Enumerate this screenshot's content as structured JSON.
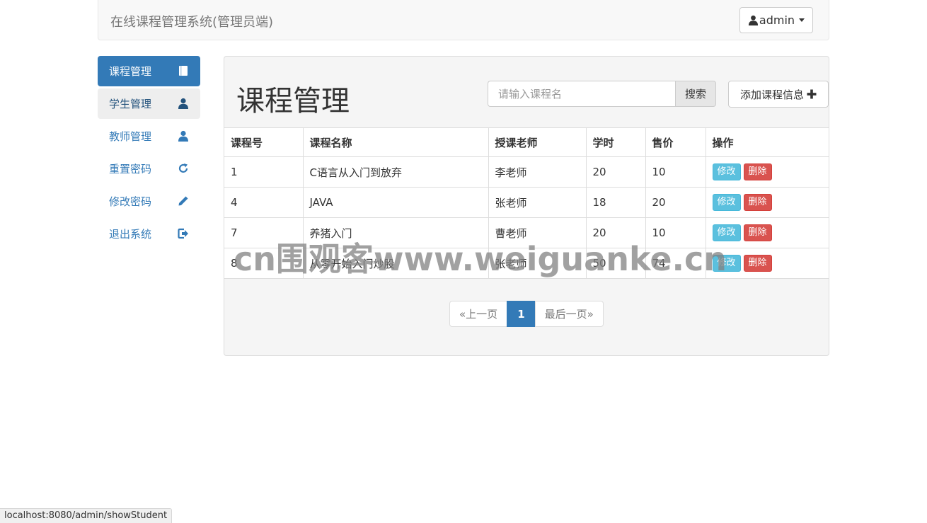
{
  "header": {
    "brand": "在线课程管理系统(管理员端)",
    "user_label": "admin"
  },
  "sidebar": {
    "items": [
      {
        "label": "课程管理",
        "icon": "book-icon"
      },
      {
        "label": "学生管理",
        "icon": "user-icon"
      },
      {
        "label": "教师管理",
        "icon": "user-icon"
      },
      {
        "label": "重置密码",
        "icon": "refresh-icon"
      },
      {
        "label": "修改密码",
        "icon": "pencil-icon"
      },
      {
        "label": "退出系统",
        "icon": "logout-icon"
      }
    ]
  },
  "main": {
    "title": "课程管理",
    "search_placeholder": "请输入课程名",
    "search_button": "搜索",
    "add_button": "添加课程信息"
  },
  "table": {
    "headers": [
      "课程号",
      "课程名称",
      "授课老师",
      "学时",
      "售价",
      "操作"
    ],
    "rows": [
      [
        "1",
        "C语言从入门到放弃",
        "李老师",
        "20",
        "10"
      ],
      [
        "4",
        "JAVA",
        "张老师",
        "18",
        "20"
      ],
      [
        "7",
        "养猪入门",
        "曹老师",
        "20",
        "10"
      ],
      [
        "8",
        "从零开始入门炒股",
        "张老师",
        "50",
        "74"
      ]
    ],
    "edit_label": "修改",
    "delete_label": "删除"
  },
  "pagination": {
    "prev": "«上一页",
    "current": "1",
    "last": "最后一页»"
  },
  "watermark": "cn围观客www.weiguanke.cn",
  "status_url": "localhost:8080/admin/showStudent"
}
